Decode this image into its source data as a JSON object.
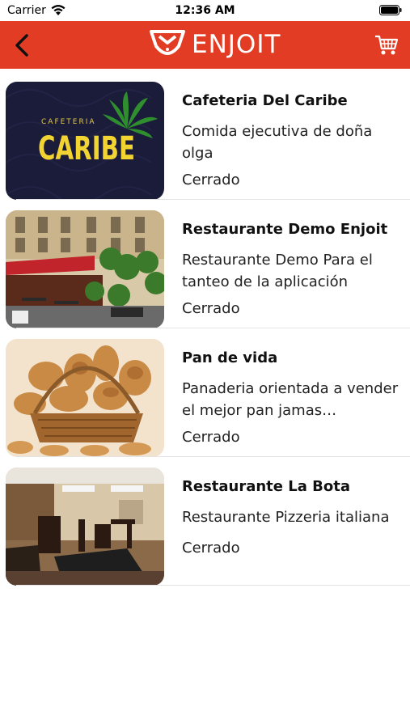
{
  "colors": {
    "nav_bg": "#E23D24",
    "white": "#FFFFFF"
  },
  "status_bar": {
    "carrier": "Carrier",
    "time": "12:36 AM"
  },
  "nav": {
    "brand_name": "ENJOIT",
    "back_icon": "chevron-left-icon",
    "cart_icon": "cart-icon"
  },
  "restaurants": [
    {
      "name": "Cafeteria Del Caribe",
      "description": "Comida ejecutiva de doña olga",
      "status": "Cerrado",
      "logo_text_small": "CAFETERIA",
      "logo_text_big": "CARIBE"
    },
    {
      "name": "Restaurante Demo Enjoit",
      "description": "Restaurante Demo Para el tanteo de la aplicación",
      "status": "Cerrado"
    },
    {
      "name": "Pan de vida",
      "description": "Panaderia orientada a vender el mejor pan jamas…",
      "status": "Cerrado"
    },
    {
      "name": "Restaurante La Bota",
      "description": "Restaurante Pizzeria italiana",
      "status": "Cerrado"
    }
  ]
}
